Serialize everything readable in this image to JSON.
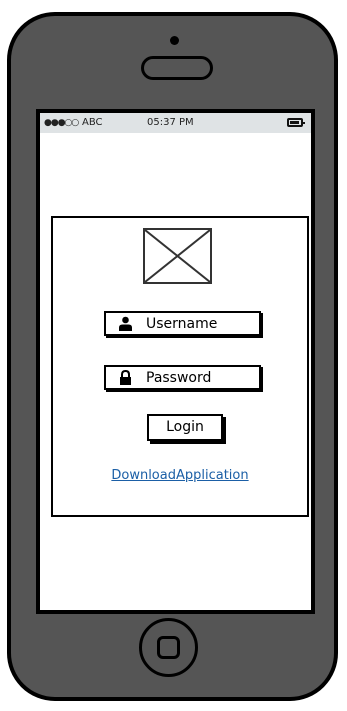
{
  "status_bar": {
    "signal": "●●●○○",
    "carrier": "ABC",
    "time": "05:37 PM",
    "battery_icon": "battery-icon"
  },
  "login_card": {
    "logo_icon": "image-placeholder-icon",
    "username": {
      "placeholder": "Username",
      "icon": "user-icon"
    },
    "password": {
      "placeholder": "Password",
      "icon": "lock-icon"
    },
    "login_button": "Login",
    "download_link": "DownloadApplication"
  },
  "colors": {
    "device_body": "#555555",
    "status_bar_bg": "#dfe3e5",
    "link": "#1b5fa6"
  }
}
